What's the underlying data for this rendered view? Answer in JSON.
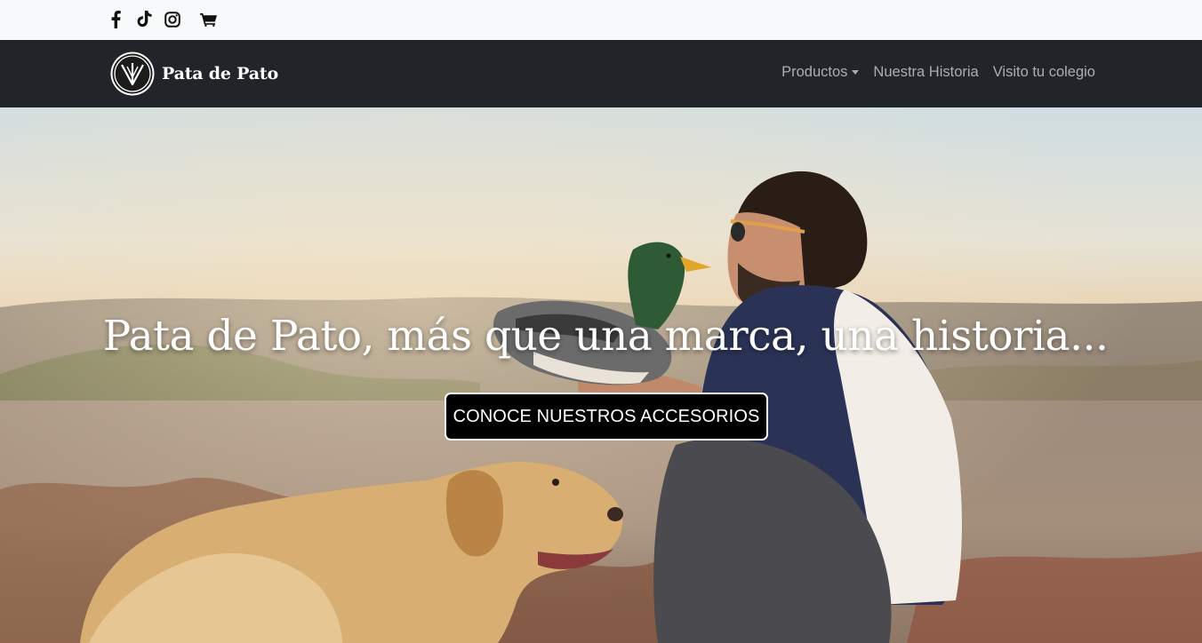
{
  "social": {
    "icons": [
      "facebook-icon",
      "tiktok-icon",
      "instagram-icon",
      "cart-icon"
    ]
  },
  "brand": {
    "name": "Pata de Pato",
    "logo_icon": "duck-foot-logo-icon"
  },
  "nav": {
    "items": [
      {
        "label": "Productos",
        "has_dropdown": true
      },
      {
        "label": "Nuestra Historia",
        "has_dropdown": false
      },
      {
        "label": "Visito tu colegio",
        "has_dropdown": false
      }
    ]
  },
  "hero": {
    "title": "Pata de Pato, más que una marca, una historia...",
    "cta_label": "CONOCE NUESTROS ACCESORIOS"
  },
  "colors": {
    "navbar_bg": "#212529",
    "topbar_bg": "#f8f9fa",
    "cta_bg": "#000000",
    "cta_text": "#ffffff"
  }
}
